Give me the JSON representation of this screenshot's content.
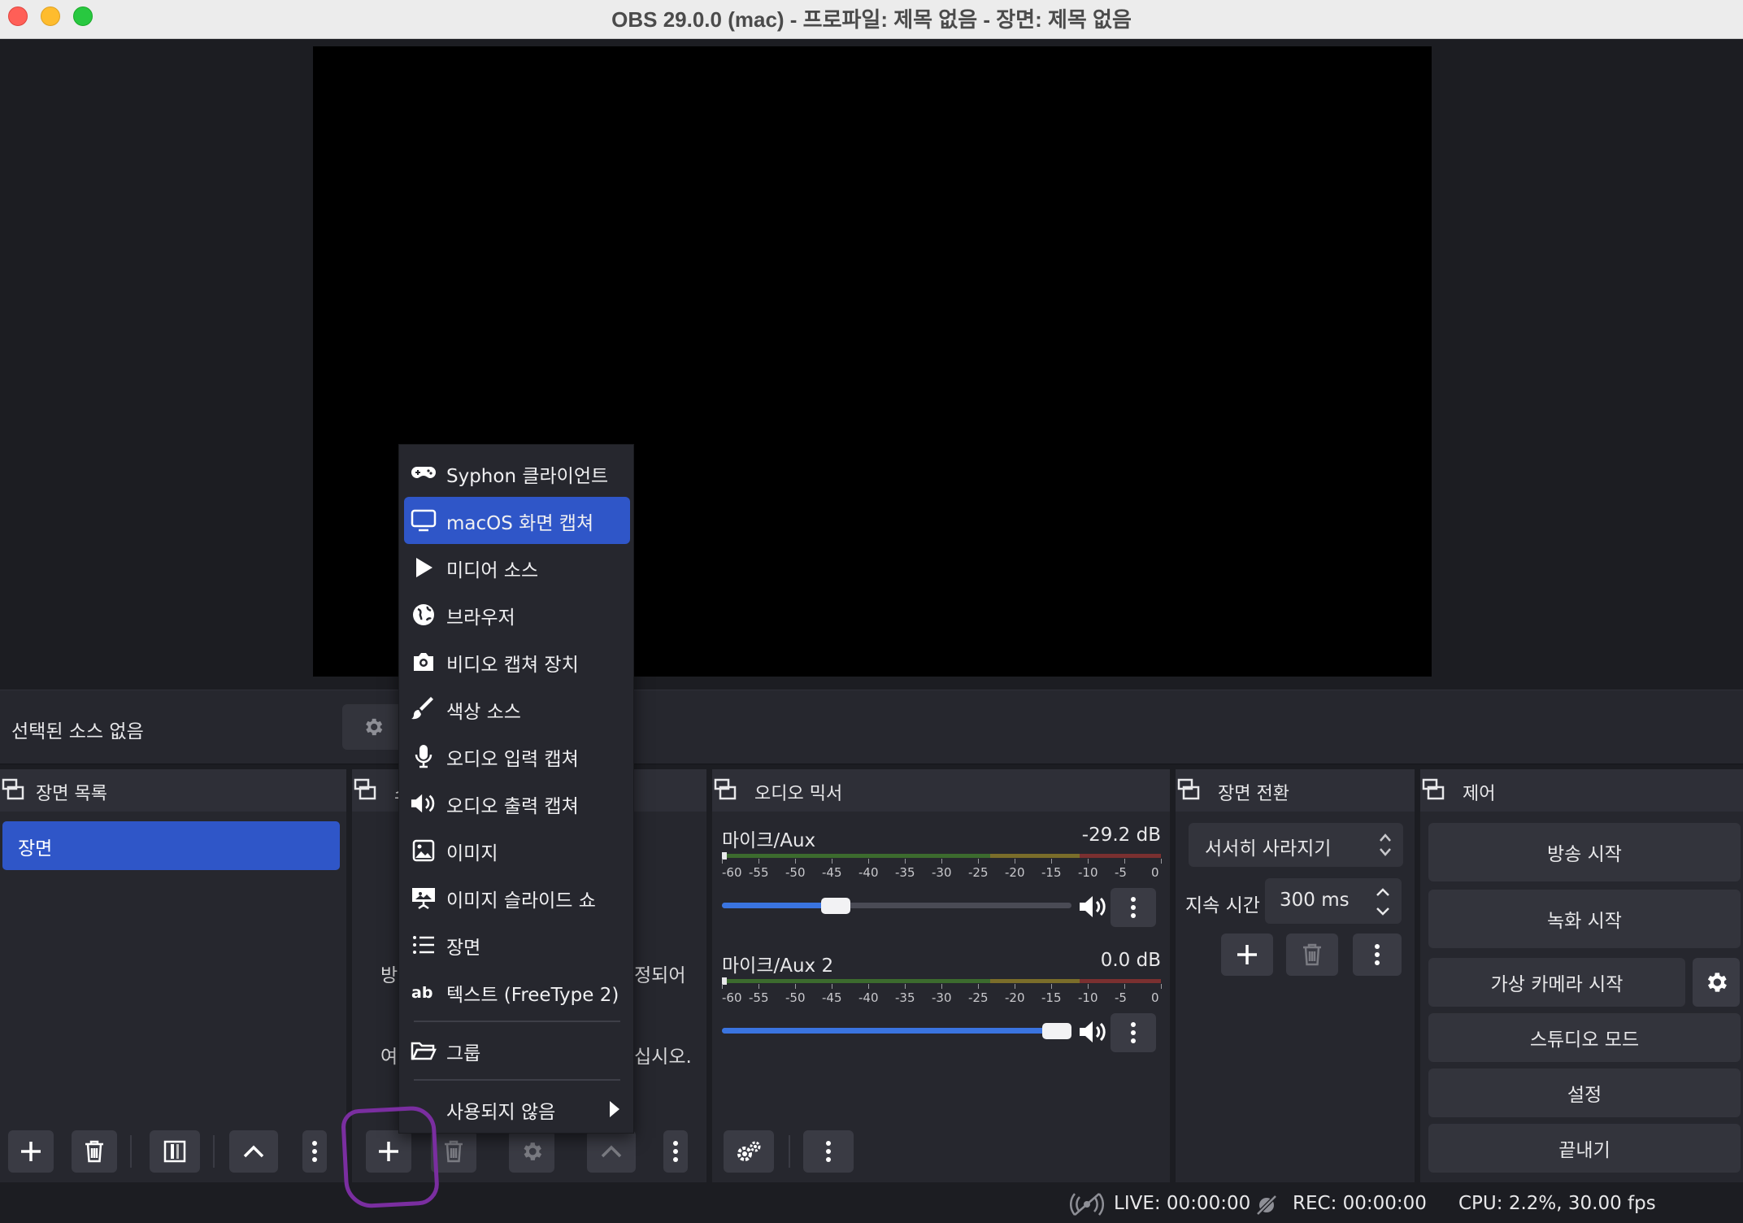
{
  "window": {
    "title": "OBS 29.0.0 (mac) - 프로파일: 제목 없음 - 장면: 제목 없음"
  },
  "context_bar": {
    "no_source_label": "선택된 소스 없음"
  },
  "scenes_dock": {
    "title": "장면 목록",
    "items": [
      {
        "label": "장면",
        "selected": true
      }
    ]
  },
  "sources_dock": {
    "title_partial": "소",
    "hint_line1_left": "방",
    "hint_line1_right": "정되어",
    "hint_line2_left": "여",
    "hint_line2_right": "십시오."
  },
  "mixer_dock": {
    "title": "오디오 믹서",
    "channels": [
      {
        "name": "마이크/Aux",
        "db": "-29.2 dB",
        "volume_fraction": 0.31
      },
      {
        "name": "마이크/Aux 2",
        "db": "0.0 dB",
        "volume_fraction": 1.0
      }
    ],
    "scale": [
      "-60",
      "-55",
      "-50",
      "-45",
      "-40",
      "-35",
      "-30",
      "-25",
      "-20",
      "-15",
      "-10",
      "-5",
      "0"
    ]
  },
  "transitions_dock": {
    "title": "장면 전환",
    "transition": "서서히 사라지기",
    "duration_label": "지속 시간",
    "duration_value": "300 ms"
  },
  "controls_dock": {
    "title": "제어",
    "buttons": {
      "stream": "방송 시작",
      "record": "녹화 시작",
      "virtual_cam": "가상 카메라 시작",
      "studio": "스튜디오 모드",
      "settings": "설정",
      "exit": "끝내기"
    }
  },
  "status": {
    "live": "LIVE: 00:00:00",
    "rec": "REC: 00:00:00",
    "cpu": "CPU: 2.2%, 30.00 fps"
  },
  "add_source_menu": {
    "items": [
      {
        "label": "Syphon 클라이언트",
        "icon": "gamepad-icon"
      },
      {
        "label": "macOS 화면 캡쳐",
        "icon": "monitor-icon",
        "selected": true
      },
      {
        "label": "미디어 소스",
        "icon": "play-icon"
      },
      {
        "label": "브라우저",
        "icon": "globe-icon"
      },
      {
        "label": "비디오 캡쳐 장치",
        "icon": "camera-icon"
      },
      {
        "label": "색상 소스",
        "icon": "brush-icon"
      },
      {
        "label": "오디오 입력 캡쳐",
        "icon": "microphone-icon"
      },
      {
        "label": "오디오 출력 캡쳐",
        "icon": "speaker-icon"
      },
      {
        "label": "이미지",
        "icon": "image-icon"
      },
      {
        "label": "이미지 슬라이드 쇼",
        "icon": "slideshow-icon"
      },
      {
        "label": "장면",
        "icon": "list-icon"
      },
      {
        "label": "텍스트 (FreeType 2)",
        "icon": "text-icon"
      },
      {
        "label": "그룹",
        "icon": "folder-icon"
      },
      {
        "label": "사용되지 않음",
        "icon": "submenu-arrow-icon"
      }
    ]
  },
  "colors": {
    "accent": "#2f56c8",
    "annotation_circle": "#7a2ea0"
  }
}
